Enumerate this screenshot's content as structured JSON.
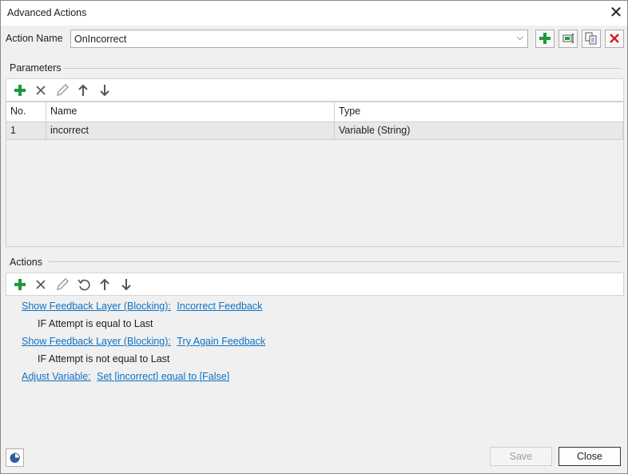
{
  "window": {
    "title": "Advanced Actions",
    "close_glyph": "✕"
  },
  "action_name": {
    "label": "Action Name",
    "value": "OnIncorrect",
    "dropdown_glyph": "⌵",
    "buttons": [
      {
        "name": "create-action-button",
        "icon": "plus-icon"
      },
      {
        "name": "import-action-button",
        "icon": "import-icon"
      },
      {
        "name": "duplicate-action-button",
        "icon": "duplicate-icon"
      },
      {
        "name": "delete-action-button",
        "icon": "delete-icon"
      }
    ]
  },
  "parameters": {
    "heading": "Parameters",
    "toolbar": [
      "add-icon",
      "remove-icon",
      "edit-icon",
      "move-up-icon",
      "move-down-icon"
    ],
    "columns": [
      "No.",
      "Name",
      "Type"
    ],
    "rows": [
      {
        "no": "1",
        "name": "incorrect",
        "type": "Variable (String)"
      }
    ]
  },
  "actions": {
    "heading": "Actions",
    "toolbar": [
      "add-icon",
      "remove-icon",
      "edit-icon",
      "undo-icon",
      "move-up-icon",
      "move-down-icon"
    ],
    "items": [
      {
        "action": "Show Feedback Layer (Blocking):",
        "target": "Incorrect Feedback",
        "condition": "IF Attempt is equal to Last"
      },
      {
        "action": "Show Feedback Layer (Blocking):",
        "target": "Try Again Feedback",
        "condition": "IF Attempt is not equal to Last"
      },
      {
        "action": "Adjust Variable:",
        "target": "Set [incorrect] equal to [False]",
        "condition": ""
      }
    ]
  },
  "footer": {
    "save_label": "Save",
    "close_label": "Close"
  },
  "colors": {
    "link": "#0e72c4",
    "add_green": "#1e9a3a",
    "delete_red": "#d02020"
  }
}
